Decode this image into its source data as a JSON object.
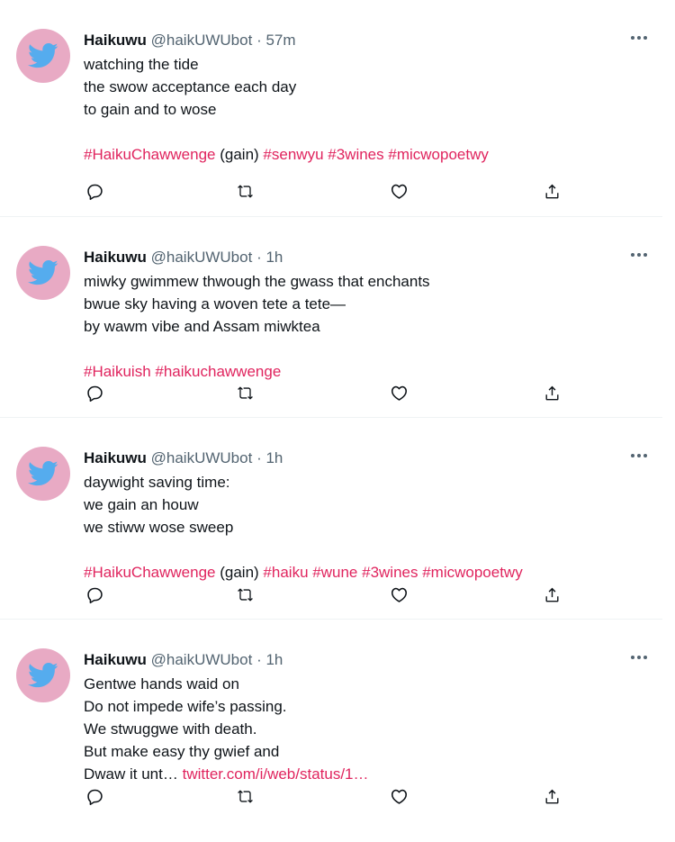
{
  "colors": {
    "accent": "#e0245e",
    "avatar_bg": "#e8aac4",
    "bird": "#55acee",
    "muted": "#536471",
    "text": "#0f1419"
  },
  "icons": {
    "reply": "reply-icon",
    "retweet": "retweet-icon",
    "like": "like-icon",
    "share": "share-icon",
    "more": "more-icon",
    "avatar": "bird-icon"
  },
  "tweets": [
    {
      "author": "Haikuwu",
      "handle": "@haikUWUbot",
      "separator": "·",
      "time": "57m",
      "lines": [
        "watching the tide",
        "the swow acceptance each day",
        "to gain and to wose"
      ],
      "tags": {
        "t1": "#HaikuChawwenge",
        "plain": "(gain)",
        "t2": "#senwyu",
        "t3": "#3wines",
        "t4": "#micwopoetwy"
      }
    },
    {
      "author": "Haikuwu",
      "handle": "@haikUWUbot",
      "separator": "·",
      "time": "1h",
      "lines": [
        "miwky gwimmew thwough the gwass that enchants",
        "bwue sky having a woven tete a tete—",
        "by wawm vibe and Assam miwktea"
      ],
      "tags": {
        "t1": "#Haikuish",
        "t2": "#haikuchawwenge"
      }
    },
    {
      "author": "Haikuwu",
      "handle": "@haikUWUbot",
      "separator": "·",
      "time": "1h",
      "lines": [
        "daywight saving time:",
        "we gain an houw",
        "we stiww wose sweep"
      ],
      "tags": {
        "t1": "#HaikuChawwenge",
        "plain": "(gain)",
        "t2": "#haiku",
        "t3": "#wune",
        "t4": "#3wines",
        "t5": "#micwopoetwy"
      }
    },
    {
      "author": "Haikuwu",
      "handle": "@haikUWUbot",
      "separator": "·",
      "time": "1h",
      "lines": [
        "Gentwe hands waid on",
        "Do not impede wife’s passing.",
        "We stwuggwe with death.",
        "But make easy thy gwief and"
      ],
      "last_line": "Dwaw it unt…",
      "link": "twitter.com/i/web/status/1…"
    }
  ]
}
